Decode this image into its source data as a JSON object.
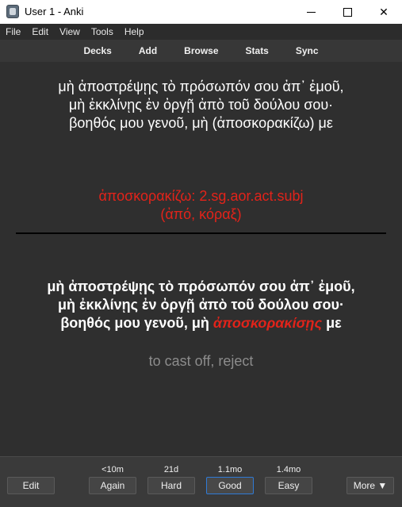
{
  "window": {
    "title": "User 1 - Anki"
  },
  "menu": [
    "File",
    "Edit",
    "View",
    "Tools",
    "Help"
  ],
  "toolbar": [
    "Decks",
    "Add",
    "Browse",
    "Stats",
    "Sync"
  ],
  "card": {
    "question_lines": [
      "μὴ ἀποστρέψῃς τὸ πρόσωπόν σου ἀπ᾽ ἐμοῦ,",
      "μὴ ἐκκλίνῃς ἐν ὀργῇ ἀπὸ τοῦ δούλου σου·",
      "βοηθός μου γενοῦ, μὴ (ἀποσκορακίζω) με"
    ],
    "parse_lines": [
      "ἀποσκορακίζω: 2.sg.aor.act.subj",
      "(ἀπό, κόραξ)"
    ],
    "answer_lines": [
      "μὴ ἀποστρέψῃς τὸ πρόσωπόν σου ἀπ᾽ ἐμοῦ,",
      "μὴ ἐκκλίνῃς ἐν ὀργῇ ἀπὸ τοῦ δούλου σου·"
    ],
    "answer_last_prefix": "βοηθός μου γενοῦ, μὴ ",
    "answer_cloze": "ἀποσκορακίσῃς",
    "answer_last_suffix": " με",
    "gloss": "to cast off, reject",
    "cloze_color": "#e2231a"
  },
  "bottom": {
    "edit_label": "Edit",
    "more_label": "More ▼",
    "answers": [
      {
        "label": "Again",
        "interval": "<10m"
      },
      {
        "label": "Hard",
        "interval": "21d"
      },
      {
        "label": "Good",
        "interval": "1.1mo"
      },
      {
        "label": "Easy",
        "interval": "1.4mo"
      }
    ]
  },
  "colors": {
    "accent": "#2f7ad6",
    "background": "#2f2f2f"
  }
}
